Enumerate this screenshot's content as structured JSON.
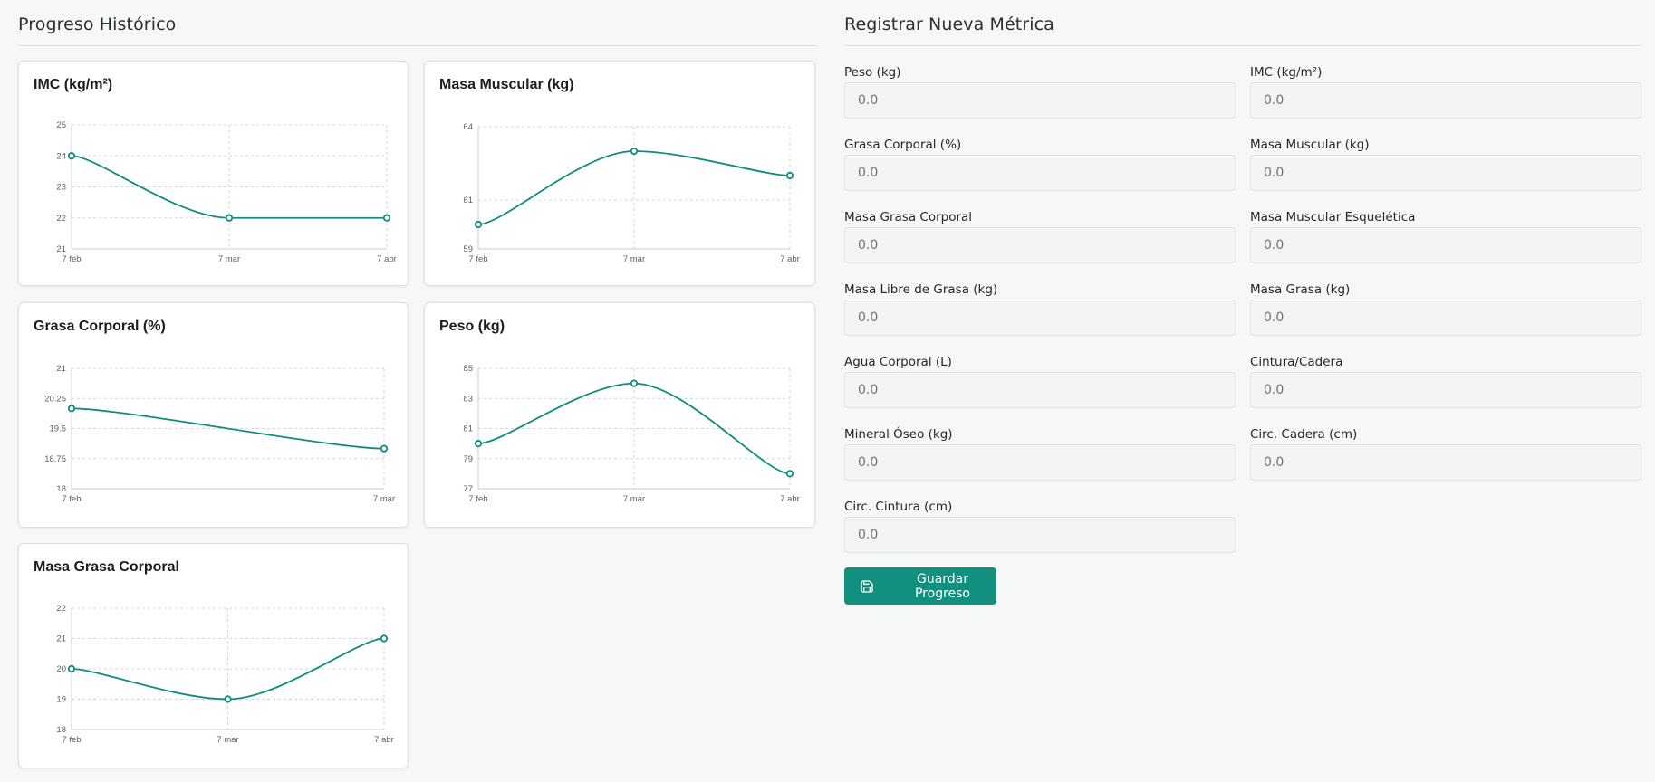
{
  "history": {
    "title": "Progreso Histórico",
    "charts": [
      {
        "title": "IMC (kg/m²)",
        "type": "line",
        "x": [
          "7 feb",
          "7 mar",
          "7 abr"
        ],
        "values": [
          24,
          22,
          22
        ],
        "yticks": [
          "21",
          "22",
          "23",
          "24",
          "25"
        ],
        "ylim": [
          21,
          25
        ],
        "grid": true,
        "line_color": "#0f8c80"
      },
      {
        "title": "Masa Muscular (kg)",
        "type": "line",
        "x": [
          "7 feb",
          "7 mar",
          "7 abr"
        ],
        "values": [
          60,
          63,
          62
        ],
        "yticks": [
          "59",
          "61",
          "64"
        ],
        "ylim": [
          59,
          64
        ],
        "grid": true,
        "line_color": "#0f8c80"
      },
      {
        "title": "Grasa Corporal (%)",
        "type": "line",
        "x": [
          "7 feb",
          "7 mar"
        ],
        "values": [
          20,
          19
        ],
        "yticks": [
          "18",
          "18.75",
          "19.5",
          "20.25",
          "21"
        ],
        "ylim": [
          18,
          21
        ],
        "grid": true,
        "line_color": "#0f8c80"
      },
      {
        "title": "Peso (kg)",
        "type": "line",
        "x": [
          "7 feb",
          "7 mar",
          "7 abr"
        ],
        "values": [
          80,
          84,
          78
        ],
        "yticks": [
          "77",
          "79",
          "81",
          "83",
          "85"
        ],
        "ylim": [
          77,
          85
        ],
        "grid": true,
        "line_color": "#0f8c80"
      },
      {
        "title": "Masa Grasa Corporal",
        "type": "line",
        "x": [
          "7 feb",
          "7 mar",
          "7 abr"
        ],
        "values": [
          20,
          19,
          21
        ],
        "yticks": [
          "18",
          "19",
          "20",
          "21",
          "22"
        ],
        "ylim": [
          18,
          22
        ],
        "grid": true,
        "line_color": "#0f8c80"
      }
    ]
  },
  "chart_data": [
    {
      "type": "line",
      "title": "IMC (kg/m²)",
      "x": [
        "7 feb",
        "7 mar",
        "7 abr"
      ],
      "series": [
        {
          "values": [
            24,
            22,
            22
          ]
        }
      ],
      "ylim": [
        21,
        25
      ],
      "grid": true
    },
    {
      "type": "line",
      "title": "Masa Muscular (kg)",
      "x": [
        "7 feb",
        "7 mar",
        "7 abr"
      ],
      "series": [
        {
          "values": [
            60,
            63,
            62
          ]
        }
      ],
      "ylim": [
        59,
        64
      ],
      "grid": true
    },
    {
      "type": "line",
      "title": "Grasa Corporal (%)",
      "x": [
        "7 feb",
        "7 mar"
      ],
      "series": [
        {
          "values": [
            20,
            19
          ]
        }
      ],
      "ylim": [
        18,
        21
      ],
      "grid": true
    },
    {
      "type": "line",
      "title": "Peso (kg)",
      "x": [
        "7 feb",
        "7 mar",
        "7 abr"
      ],
      "series": [
        {
          "values": [
            80,
            84,
            78
          ]
        }
      ],
      "ylim": [
        77,
        85
      ],
      "grid": true
    },
    {
      "type": "line",
      "title": "Masa Grasa Corporal",
      "x": [
        "7 feb",
        "7 mar",
        "7 abr"
      ],
      "series": [
        {
          "values": [
            20,
            19,
            21
          ]
        }
      ],
      "ylim": [
        18,
        22
      ],
      "grid": true
    }
  ],
  "form": {
    "title": "Registrar Nueva Métrica",
    "fields": [
      {
        "label": "Peso (kg)",
        "placeholder": "0.0",
        "value": ""
      },
      {
        "label": "IMC (kg/m²)",
        "placeholder": "0.0",
        "value": ""
      },
      {
        "label": "Grasa Corporal (%)",
        "placeholder": "0.0",
        "value": ""
      },
      {
        "label": "Masa Muscular (kg)",
        "placeholder": "0.0",
        "value": ""
      },
      {
        "label": "Masa Grasa Corporal",
        "placeholder": "0.0",
        "value": ""
      },
      {
        "label": "Masa Muscular Esquelética",
        "placeholder": "0.0",
        "value": ""
      },
      {
        "label": "Masa Libre de Grasa (kg)",
        "placeholder": "0.0",
        "value": ""
      },
      {
        "label": "Masa Grasa (kg)",
        "placeholder": "0.0",
        "value": ""
      },
      {
        "label": "Agua Corporal (L)",
        "placeholder": "0.0",
        "value": ""
      },
      {
        "label": "Cintura/Cadera",
        "placeholder": "0.0",
        "value": ""
      },
      {
        "label": "Mineral Óseo (kg)",
        "placeholder": "0.0",
        "value": ""
      },
      {
        "label": "Circ. Cadera (cm)",
        "placeholder": "0.0",
        "value": ""
      },
      {
        "label": "Circ. Cintura (cm)",
        "placeholder": "0.0",
        "value": ""
      }
    ],
    "save_label": "Guardar Progreso",
    "save_icon": "save-icon",
    "accent_color": "#11907f"
  }
}
